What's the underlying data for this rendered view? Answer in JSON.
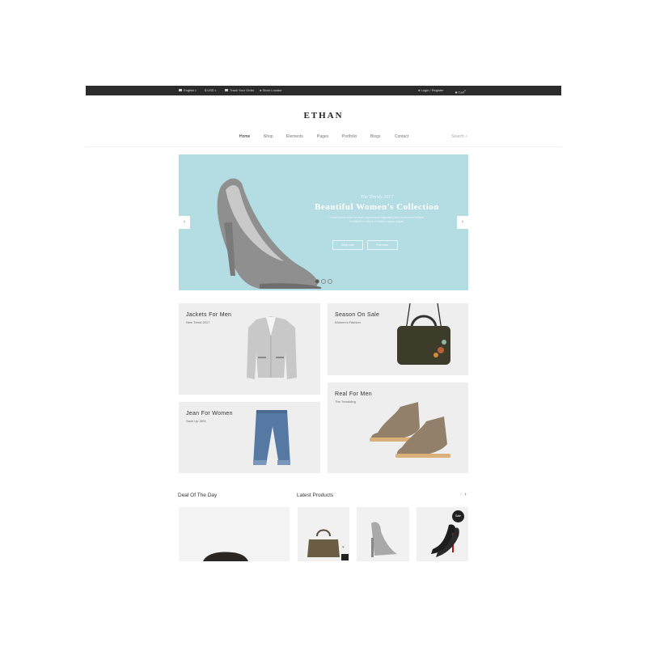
{
  "topbar": {
    "language": "English",
    "currency": "USD",
    "track_order": "Track Your Order",
    "store_locator": "Store Locator",
    "login": "Login",
    "separator": "/",
    "register": "Register",
    "cart": "Cart",
    "cart_count": "0"
  },
  "logo": "ETHAN",
  "nav": {
    "items": [
      "Home",
      "Shop",
      "Elements",
      "Pages",
      "Portfolio",
      "Blogs",
      "Contact"
    ],
    "search_placeholder": "Search"
  },
  "hero": {
    "subtitle": "The Trendy 2017",
    "title": "Beautiful Women's Collection",
    "description_line1": "Lorem ipsum dolor sit amet, consectetur adipisicing elit, do eiusmod tempor",
    "description_line2": "incididunt ut labore et dolore magna aliqua.",
    "btn_shop": "Shop Now",
    "btn_purchase": "Purchase",
    "prev": "‹",
    "next": "›"
  },
  "banners": [
    {
      "title": "Jackets For Men",
      "subtitle": "New Trend 2017"
    },
    {
      "title": "Season On Sale",
      "subtitle": "Women's Fashion"
    },
    {
      "title": "Jean For Women",
      "subtitle": "Save Up 35%"
    },
    {
      "title": "Real For Men",
      "subtitle": "The Trendding"
    }
  ],
  "sections": {
    "deal": "Deal Of The Day",
    "latest": "Latest Products",
    "prev": "‹",
    "next": "›"
  },
  "products": {
    "sale_badge": "Sale"
  },
  "colors": {
    "topbar_bg": "#2b2b2b",
    "hero_bg": "#b3dde3",
    "banner_bg": "#eeeeee"
  }
}
